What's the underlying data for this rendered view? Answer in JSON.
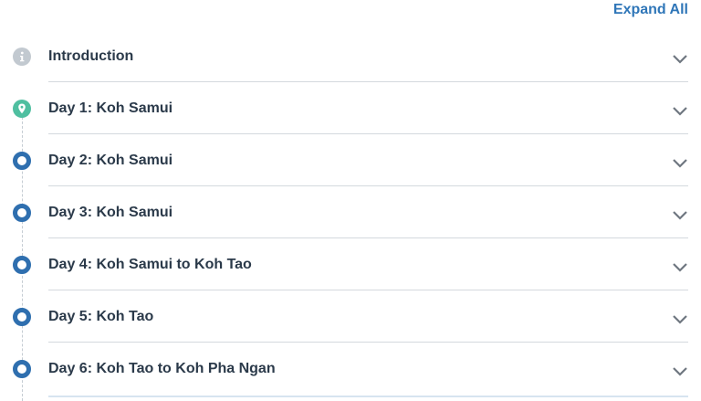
{
  "header": {
    "expand_all_label": "Expand All"
  },
  "itinerary": {
    "items": [
      {
        "label": "Introduction",
        "icon": "info-icon"
      },
      {
        "label": "Day 1: Koh Samui",
        "icon": "map-pin-icon"
      },
      {
        "label": "Day 2: Koh Samui",
        "icon": "ring-marker-icon"
      },
      {
        "label": "Day 3: Koh Samui",
        "icon": "ring-marker-icon"
      },
      {
        "label": "Day 4: Koh Samui to Koh Tao",
        "icon": "ring-marker-icon"
      },
      {
        "label": "Day 5: Koh Tao",
        "icon": "ring-marker-icon"
      },
      {
        "label": "Day 6: Koh Tao to Koh Pha Ngan",
        "icon": "ring-marker-icon"
      }
    ]
  },
  "colors": {
    "link": "#2f76b8",
    "info_marker": "#c2c9d0",
    "location_marker": "#4fbfa0",
    "day_marker_ring": "#2f6faf",
    "text": "#2b3a4a",
    "chevron": "#6f7780"
  }
}
